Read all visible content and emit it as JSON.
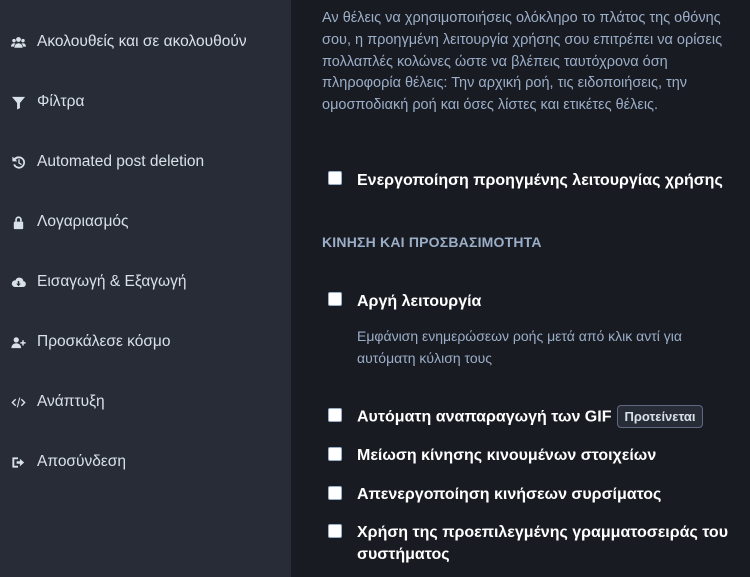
{
  "sidebar": {
    "items": [
      {
        "label": "Ακολουθείς και σε ακολουθούν",
        "icon": "users-icon"
      },
      {
        "label": "Φίλτρα",
        "icon": "filter-icon"
      },
      {
        "label": "Automated post deletion",
        "icon": "history-icon"
      },
      {
        "label": "Λογαριασμός",
        "icon": "lock-icon"
      },
      {
        "label": "Εισαγωγή & Εξαγωγή",
        "icon": "cloud-download-icon"
      },
      {
        "label": "Προσκάλεσε κόσμο",
        "icon": "user-plus-icon"
      },
      {
        "label": "Ανάπτυξη",
        "icon": "code-icon"
      },
      {
        "label": "Αποσύνδεση",
        "icon": "sign-out-icon"
      }
    ]
  },
  "main": {
    "intro_text": "Αν θέλεις να χρησιμοποιήσεις ολόκληρο το πλάτος της οθόνης σου, η προηγμένη λειτουργία χρήσης σου επιτρέπει να ορίσεις πολλαπλές κολώνες ώστε να βλέπεις ταυτόχρονα όση πληροφορία θέλεις: Την αρχική ροή, τις ειδοποιήσεις, την ομοσποδιακή ροή και όσες λίστες και ετικέτες θέλεις.",
    "advanced_mode_label": "Ενεργοποίηση προηγμένης λειτουργίας χρήσης",
    "section_heading": "ΚΙΝΗΣΗ ΚΑΙ ΠΡΟΣΒΑΣΙΜΟΤΗΤΑ",
    "slow_mode_label": "Αργή λειτουργία",
    "slow_mode_hint": "Εμφάνιση ενημερώσεων ροής μετά από κλικ αντί για αυτόματη κύλιση τους",
    "autoplay_gif_label": "Αυτόματη αναπαραγωγή των GIF",
    "recommended_badge": "Προτείνεται",
    "reduce_motion_label": "Μείωση κίνησης κινουμένων στοιχείων",
    "disable_swipe_label": "Απενεργοποίηση κινήσεων συρσίματος",
    "system_font_label": "Χρήση της προεπιλεγμένης γραμματοσειράς του συστήματος"
  },
  "colors": {
    "sidebar_bg": "#282c37",
    "main_bg": "#191b22",
    "sidebar_text": "#d9e1e8",
    "muted_text": "#9baec8",
    "label_text": "#ffffff"
  }
}
